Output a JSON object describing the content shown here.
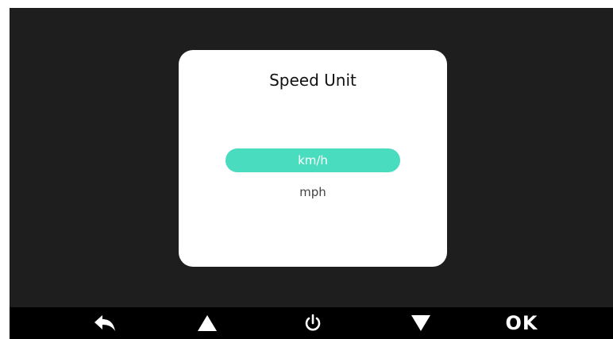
{
  "dialog": {
    "title": "Speed Unit",
    "options": [
      {
        "label": "km/h",
        "selected": true
      },
      {
        "label": "mph",
        "selected": false
      }
    ]
  },
  "bottom_bar": {
    "buttons": [
      {
        "icon": "back-arrow-icon"
      },
      {
        "icon": "up-triangle-icon"
      },
      {
        "icon": "power-icon"
      },
      {
        "icon": "down-triangle-icon"
      },
      {
        "label": "OK"
      }
    ]
  },
  "colors": {
    "screen_background": "#1e1e1e",
    "dialog_background": "#ffffff",
    "selection_accent": "#49dcbf",
    "bottom_bar_background": "#000000"
  }
}
